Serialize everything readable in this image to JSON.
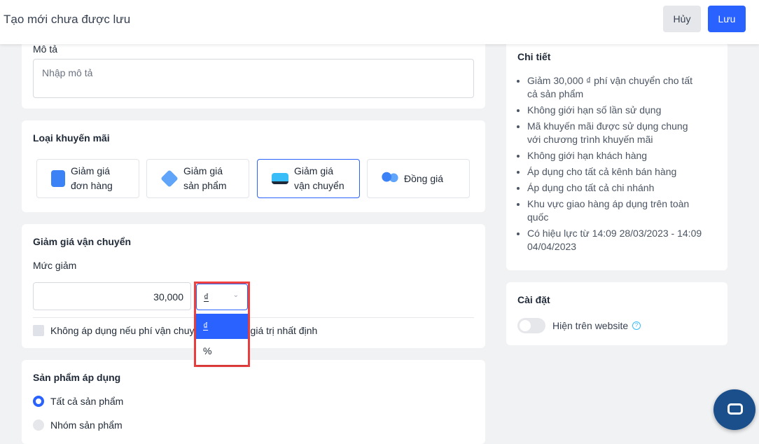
{
  "header": {
    "title": "Tạo mới chưa được lưu",
    "cancel": "Hủy",
    "save": "Lưu"
  },
  "description": {
    "label": "Mô tả",
    "placeholder": "Nhập mô tả"
  },
  "promo_type": {
    "label": "Loại khuyến mãi",
    "options": [
      {
        "l1": "Giảm giá",
        "l2": "đơn hàng",
        "icon": "receipt-icon"
      },
      {
        "l1": "Giảm giá",
        "l2": "sản phẩm",
        "icon": "price-tag-icon"
      },
      {
        "l1": "Giảm giá",
        "l2": "vận chuyển",
        "icon": "truck-icon"
      },
      {
        "l1": "Đồng giá",
        "l2": "",
        "icon": "balloons-icon"
      }
    ],
    "selected": 2
  },
  "shipping": {
    "title": "Giảm giá vận chuyển",
    "level_label": "Mức giảm",
    "value": "30,000",
    "unit": "₫",
    "unit_options": [
      "₫",
      "%"
    ],
    "checkbox_label": "Không áp dụng nếu phí vận chuyển vượt quá giá trị nhất định"
  },
  "products": {
    "title": "Sản phẩm áp dụng",
    "options": [
      "Tất cả sản phẩm",
      "Nhóm sản phẩm"
    ]
  },
  "details": {
    "title": "Chi tiết",
    "items": [
      "Giảm 30,000 ₫ phí vận chuyển cho tất cả sản phẩm",
      "Không giới hạn số lần sử dụng",
      "Mã khuyến mãi được sử dụng chung với chương trình khuyến mãi",
      "Không giới hạn khách hàng",
      "Áp dụng cho tất cả kênh bán hàng",
      "Áp dụng cho tất cả chi nhánh",
      "Khu vực giao hàng áp dụng trên toàn quốc",
      "Có hiệu lực từ 14:09 28/03/2023 - 14:09 04/04/2023"
    ]
  },
  "settings": {
    "title": "Cài đặt",
    "toggle_label": "Hiện trên website",
    "toggle_on": false
  },
  "colors": {
    "accent": "#2962ff",
    "highlight": "#f04040"
  }
}
